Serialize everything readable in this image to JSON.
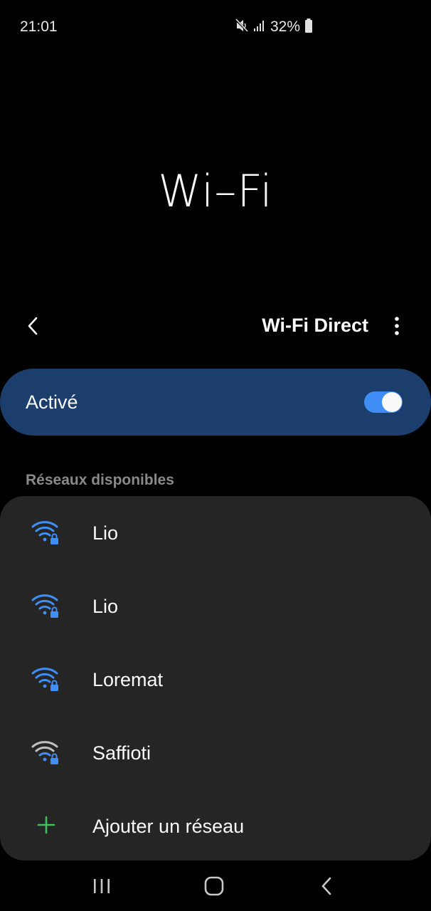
{
  "status_bar": {
    "time": "21:01",
    "battery": "32%",
    "icons": [
      "mute-icon",
      "signal-icon",
      "battery-icon"
    ]
  },
  "header": {
    "title": "Wi–Fi"
  },
  "toolbar": {
    "back_icon": "back-arrow-icon",
    "wifi_direct_label": "Wi-Fi Direct",
    "more_icon": "more-vert-icon"
  },
  "toggle": {
    "label": "Activé",
    "state": "on",
    "accent_color": "#3f8ef6",
    "card_color": "#1b3e6c"
  },
  "networks_section": {
    "label": "Réseaux disponibles",
    "networks": [
      {
        "name": "Lio",
        "icon": "wifi-locked-icon",
        "color": "#3f8ef6"
      },
      {
        "name": "Lio",
        "icon": "wifi-locked-icon",
        "color": "#3f8ef6"
      },
      {
        "name": "Loremat",
        "icon": "wifi-locked-icon",
        "color": "#3f8ef6"
      },
      {
        "name": "Saffioti",
        "icon": "wifi-locked-icon",
        "color": "#bfbfbf"
      }
    ],
    "add_network": {
      "label": "Ajouter un réseau",
      "icon": "plus-icon",
      "color": "#3fc15a"
    }
  },
  "nav_bar": {
    "buttons": [
      "recent-apps-icon",
      "home-icon",
      "back-icon"
    ]
  }
}
